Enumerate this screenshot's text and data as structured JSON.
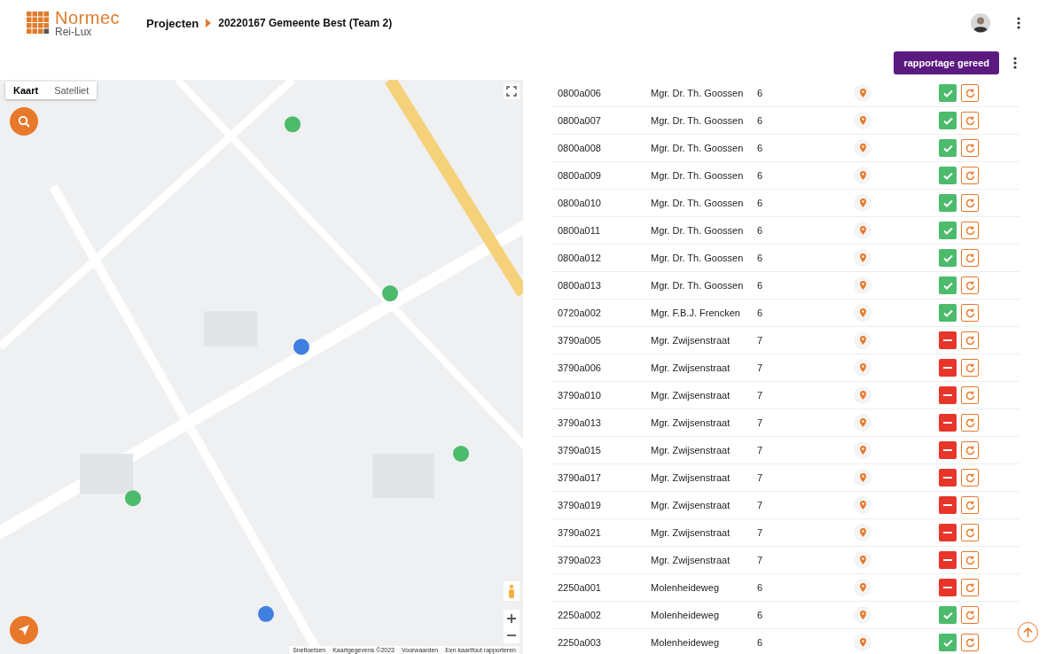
{
  "header": {
    "logo": {
      "name": "Normec",
      "sub": "Rei-Lux"
    },
    "breadcrumb": [
      "Projecten",
      "20220167 Gemeente Best (Team 2)"
    ]
  },
  "toolbar": {
    "button": "rapportage gereed"
  },
  "map": {
    "kind": "picture",
    "tabs": [
      {
        "label": "Kaart",
        "selected": true
      },
      {
        "label": "Satelliet",
        "selected": false
      }
    ],
    "attribution": [
      "Sneltoetsen",
      "Kaartgegevens ©2023",
      "Voorwaarden",
      "Een kaartfout rapporteren"
    ]
  },
  "rows": [
    {
      "code": "0800a006",
      "street": "Mgr. Dr. Th. Goossen",
      "number": "6",
      "approved": true
    },
    {
      "code": "0800a007",
      "street": "Mgr. Dr. Th. Goossen",
      "number": "6",
      "approved": true
    },
    {
      "code": "0800a008",
      "street": "Mgr. Dr. Th. Goossen",
      "number": "6",
      "approved": true
    },
    {
      "code": "0800a009",
      "street": "Mgr. Dr. Th. Goossen",
      "number": "6",
      "approved": true
    },
    {
      "code": "0800a010",
      "street": "Mgr. Dr. Th. Goossen",
      "number": "6",
      "approved": true
    },
    {
      "code": "0800a011",
      "street": "Mgr. Dr. Th. Goossen",
      "number": "6",
      "approved": true
    },
    {
      "code": "0800a012",
      "street": "Mgr. Dr. Th. Goossen",
      "number": "6",
      "approved": true
    },
    {
      "code": "0800a013",
      "street": "Mgr. Dr. Th. Goossen",
      "number": "6",
      "approved": true
    },
    {
      "code": "0720a002",
      "street": "Mgr. F.B.J. Frencken",
      "number": "6",
      "approved": true
    },
    {
      "code": "3790a005",
      "street": "Mgr. Zwijsenstraat",
      "number": "7",
      "approved": false
    },
    {
      "code": "3790a006",
      "street": "Mgr. Zwijsenstraat",
      "number": "7",
      "approved": false
    },
    {
      "code": "3790a010",
      "street": "Mgr. Zwijsenstraat",
      "number": "7",
      "approved": false
    },
    {
      "code": "3790a013",
      "street": "Mgr. Zwijsenstraat",
      "number": "7",
      "approved": false
    },
    {
      "code": "3790a015",
      "street": "Mgr. Zwijsenstraat",
      "number": "7",
      "approved": false
    },
    {
      "code": "3790a017",
      "street": "Mgr. Zwijsenstraat",
      "number": "7",
      "approved": false
    },
    {
      "code": "3790a019",
      "street": "Mgr. Zwijsenstraat",
      "number": "7",
      "approved": false
    },
    {
      "code": "3790a021",
      "street": "Mgr. Zwijsenstraat",
      "number": "7",
      "approved": false
    },
    {
      "code": "3790a023",
      "street": "Mgr. Zwijsenstraat",
      "number": "7",
      "approved": false
    },
    {
      "code": "2250a001",
      "street": "Molenheideweg",
      "number": "6",
      "approved": false
    },
    {
      "code": "2250a002",
      "street": "Molenheideweg",
      "number": "6",
      "approved": true
    },
    {
      "code": "2250a003",
      "street": "Molenheideweg",
      "number": "6",
      "approved": true
    }
  ]
}
